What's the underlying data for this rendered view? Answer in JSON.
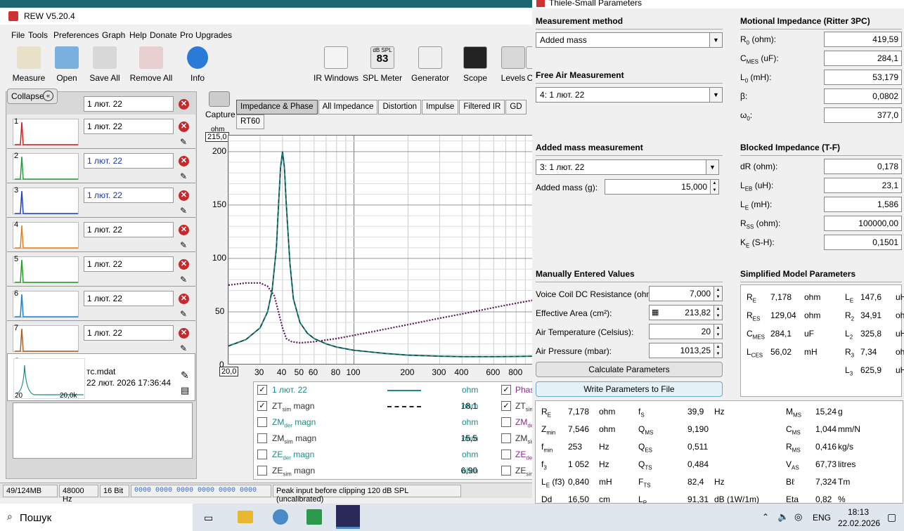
{
  "rew": {
    "title": "REW V5.20.4",
    "menu": [
      "File",
      "Tools",
      "Preferences",
      "Graph",
      "Help",
      "Donate",
      "Pro Upgrades"
    ],
    "toolbar": [
      "Measure",
      "Open",
      "Save All",
      "Remove All",
      "Info"
    ],
    "toolbar_right": [
      "IR Windows",
      "SPL Meter",
      "Generator",
      "Scope",
      "Levels",
      "C"
    ],
    "spl_meter_value": "83",
    "spl_meter_unit": "dB SPL",
    "collapse": "Collapse",
    "capture": "Capture",
    "measurements": [
      {
        "idx": "",
        "name": "1 лют. 22",
        "color": "#000"
      },
      {
        "idx": "1",
        "name": "1 лют. 22",
        "color": "#d02020"
      },
      {
        "idx": "2",
        "name": "1 лют. 22",
        "color": "#20a040"
      },
      {
        "idx": "3",
        "name": "1 лют. 22",
        "color": "#2040c0"
      },
      {
        "idx": "4",
        "name": "1 лют. 22",
        "color": "#e08020"
      },
      {
        "idx": "5",
        "name": "1 лют. 22",
        "color": "#20a020"
      },
      {
        "idx": "6",
        "name": "1 лют. 22",
        "color": "#2080d0"
      },
      {
        "idx": "7",
        "name": "1 лют. 22",
        "color": "#b06020"
      }
    ],
    "selected": {
      "idx": "8",
      "file": "тс.mdat",
      "date": "22 лют. 2026 17:36:44",
      "lo": "20",
      "hi": "20,0k"
    },
    "tabs": [
      "Impedance & Phase",
      "All Impedance",
      "Distortion",
      "Impulse",
      "Filtered IR",
      "GD",
      "RT60"
    ],
    "plot": {
      "unit": "ohm",
      "top": "215,0",
      "left": "20,0",
      "yticks": [
        "200",
        "150",
        "100",
        "50",
        "0"
      ],
      "xticks": [
        "30",
        "40",
        "50",
        "60",
        "80",
        "100",
        "200",
        "300",
        "400",
        "600",
        "800"
      ]
    },
    "legend": [
      {
        "checked": true,
        "name": "1 лют. 22",
        "value": "",
        "unit": "ohm",
        "right": "Phas",
        "rchecked": true,
        "line": "solid"
      },
      {
        "checked": true,
        "name": "ZT",
        "sub": "sim",
        "suffix": " magn",
        "value": "18,1",
        "unit": "ohm",
        "right": "ZT",
        "rsub": "sim",
        "rchecked": true,
        "line": "dash"
      },
      {
        "checked": false,
        "name": "ZM",
        "sub": "der",
        "suffix": " magn",
        "value": "",
        "unit": "ohm",
        "right": "ZM",
        "rsub": "de",
        "rchecked": false
      },
      {
        "checked": false,
        "name": "ZM",
        "sub": "sim",
        "suffix": " magn",
        "value": "15,5",
        "unit": "ohm",
        "right": "ZM",
        "rsub": "sim",
        "rchecked": false
      },
      {
        "checked": false,
        "name": "ZE",
        "sub": "der",
        "suffix": " magn",
        "value": "",
        "unit": "ohm",
        "right": "ZE",
        "rsub": "de",
        "rchecked": false
      },
      {
        "checked": false,
        "name": "ZE",
        "sub": "sim",
        "suffix": " magn",
        "value": "6,90",
        "unit": "ohm",
        "right": "ZE",
        "rsub": "sim",
        "rchecked": false
      }
    ],
    "status": [
      "49/124MB",
      "48000 Hz",
      "16 Bit",
      "0000 0000  0000 0000  0000 0000",
      "Peak input before clipping 120 dB SPL (uncalibrated)"
    ]
  },
  "ts": {
    "title": "Thiele-Small Parameters",
    "meas_method_h": "Measurement method",
    "meas_method": "Added mass",
    "free_air_h": "Free Air Measurement",
    "free_air": "4: 1 лют. 22",
    "added_h": "Added mass measurement",
    "added": "3: 1 лют. 22",
    "added_mass_lbl": "Added mass (g):",
    "added_mass": "15,000",
    "manual_h": "Manually Entered Values",
    "manual": [
      {
        "label": "Voice Coil DC Resistance (ohm):",
        "value": "7,000"
      },
      {
        "label": "Effective Area (cm²):",
        "value": "213,82"
      },
      {
        "label": "Air Temperature (Celsius):",
        "value": "20"
      },
      {
        "label": "Air Pressure (mbar):",
        "value": "1013,25"
      }
    ],
    "calc_btn": "Calculate Parameters",
    "write_btn": "Write Parameters to File",
    "motional_h": "Motional Impedance (Ritter 3PC)",
    "motional": [
      {
        "l": "R",
        "s": "0",
        "u": " (ohm):",
        "v": "419,59"
      },
      {
        "l": "C",
        "s": "MES",
        "u": " (uF):",
        "v": "284,1"
      },
      {
        "l": "L",
        "s": "0",
        "u": " (mH):",
        "v": "53,179"
      },
      {
        "l": "β:",
        "s": "",
        "u": "",
        "v": "0,0802"
      },
      {
        "l": "ω",
        "s": "0",
        "u": ":",
        "v": "377,0"
      }
    ],
    "blocked_h": "Blocked Impedance (T-F)",
    "blocked": [
      {
        "l": "dR (ohm):",
        "s": "",
        "u": "",
        "v": "0,178"
      },
      {
        "l": "L",
        "s": "EB",
        "u": " (uH):",
        "v": "23,1"
      },
      {
        "l": "L",
        "s": "E",
        "u": " (mH):",
        "v": "1,586"
      },
      {
        "l": "R",
        "s": "SS",
        "u": " (ohm):",
        "v": "100000,00"
      },
      {
        "l": "K",
        "s": "E",
        "u": " (S-H):",
        "v": "0,1501"
      }
    ],
    "simplified_h": "Simplified Model Parameters",
    "simplified_left": [
      {
        "l": "R",
        "s": "E",
        "v": "7,178",
        "u": "ohm"
      },
      {
        "l": "R",
        "s": "ES",
        "v": "129,04",
        "u": "ohm"
      },
      {
        "l": "C",
        "s": "MES",
        "v": "284,1",
        "u": "uF"
      },
      {
        "l": "L",
        "s": "CES",
        "v": "56,02",
        "u": "mH"
      }
    ],
    "simplified_right": [
      {
        "l": "L",
        "s": "E",
        "v": "147,6",
        "u": "uH"
      },
      {
        "l": "R",
        "s": "2",
        "v": "34,91",
        "u": "ohm"
      },
      {
        "l": "L",
        "s": "2",
        "v": "325,8",
        "u": "uH"
      },
      {
        "l": "R",
        "s": "3",
        "v": "7,34",
        "u": "ohm"
      },
      {
        "l": "L",
        "s": "3",
        "v": "625,9",
        "u": "uH"
      }
    ],
    "results": [
      [
        {
          "l": "R",
          "s": "E",
          "v": "7,178",
          "u": "ohm"
        },
        {
          "l": "f",
          "s": "S",
          "v": "39,9",
          "u": "Hz"
        },
        {
          "l": "M",
          "s": "MS",
          "v": "15,24",
          "u": "g"
        }
      ],
      [
        {
          "l": "Z",
          "s": "min",
          "v": "7,546",
          "u": "ohm"
        },
        {
          "l": "Q",
          "s": "MS",
          "v": "9,190",
          "u": ""
        },
        {
          "l": "C",
          "s": "MS",
          "v": "1,044",
          "u": "mm/N"
        }
      ],
      [
        {
          "l": "f",
          "s": "min",
          "v": "253",
          "u": "Hz"
        },
        {
          "l": "Q",
          "s": "ES",
          "v": "0,511",
          "u": ""
        },
        {
          "l": "R",
          "s": "MS",
          "v": "0,416",
          "u": "kg/s"
        }
      ],
      [
        {
          "l": "f",
          "s": "3",
          "v": "1 052",
          "u": "Hz"
        },
        {
          "l": "Q",
          "s": "TS",
          "v": "0,484",
          "u": ""
        },
        {
          "l": "V",
          "s": "AS",
          "v": "67,73",
          "u": "litres"
        }
      ],
      [
        {
          "l": "L",
          "s": "E",
          "x": " (f3)",
          "v": "0,840",
          "u": "mH"
        },
        {
          "l": "F",
          "s": "TS",
          "v": "82,4",
          "u": "Hz"
        },
        {
          "l": "Bℓ",
          "s": "",
          "v": "7,324",
          "u": "Tm"
        }
      ],
      [
        {
          "l": "Dd",
          "s": "",
          "v": "16,50",
          "u": "cm"
        },
        {
          "l": "L",
          "s": "P",
          "v": "91,31",
          "u": "dB (1W/1m)"
        },
        {
          "l": "Eta",
          "s": "",
          "v": "0,82",
          "u": "%"
        }
      ]
    ]
  },
  "taskbar": {
    "search": "Пошук",
    "lang": "ENG",
    "time": "18:13",
    "date": "22.02.2026"
  },
  "chart_data": {
    "type": "line",
    "xscale": "log",
    "xlim": [
      20,
      1000
    ],
    "ylim": [
      0,
      215
    ],
    "ylabel": "ohm",
    "series": [
      {
        "name": "1 лют. 22",
        "color": "#1e8a86",
        "x": [
          20,
          25,
          30,
          33,
          35,
          37,
          38,
          39,
          40,
          41,
          42,
          44,
          46,
          50,
          55,
          60,
          70,
          80,
          100,
          150,
          200,
          300,
          400,
          600,
          800,
          1000
        ],
        "values": [
          18,
          24,
          35,
          50,
          70,
          110,
          150,
          185,
          200,
          185,
          150,
          95,
          62,
          40,
          30,
          25,
          20,
          17,
          14,
          11,
          9.5,
          8.5,
          8,
          8,
          8.2,
          8.5
        ]
      },
      {
        "name": "Phase",
        "color": "#5a1a5a",
        "x": [
          20,
          25,
          30,
          33,
          36,
          38,
          40,
          42,
          45,
          50,
          60,
          80,
          100,
          200,
          300,
          400,
          600,
          800,
          1000
        ],
        "values": [
          75,
          77,
          77,
          74,
          65,
          50,
          35,
          25,
          22,
          21,
          22,
          25,
          28,
          38,
          44,
          48,
          54,
          58,
          61
        ]
      }
    ]
  }
}
